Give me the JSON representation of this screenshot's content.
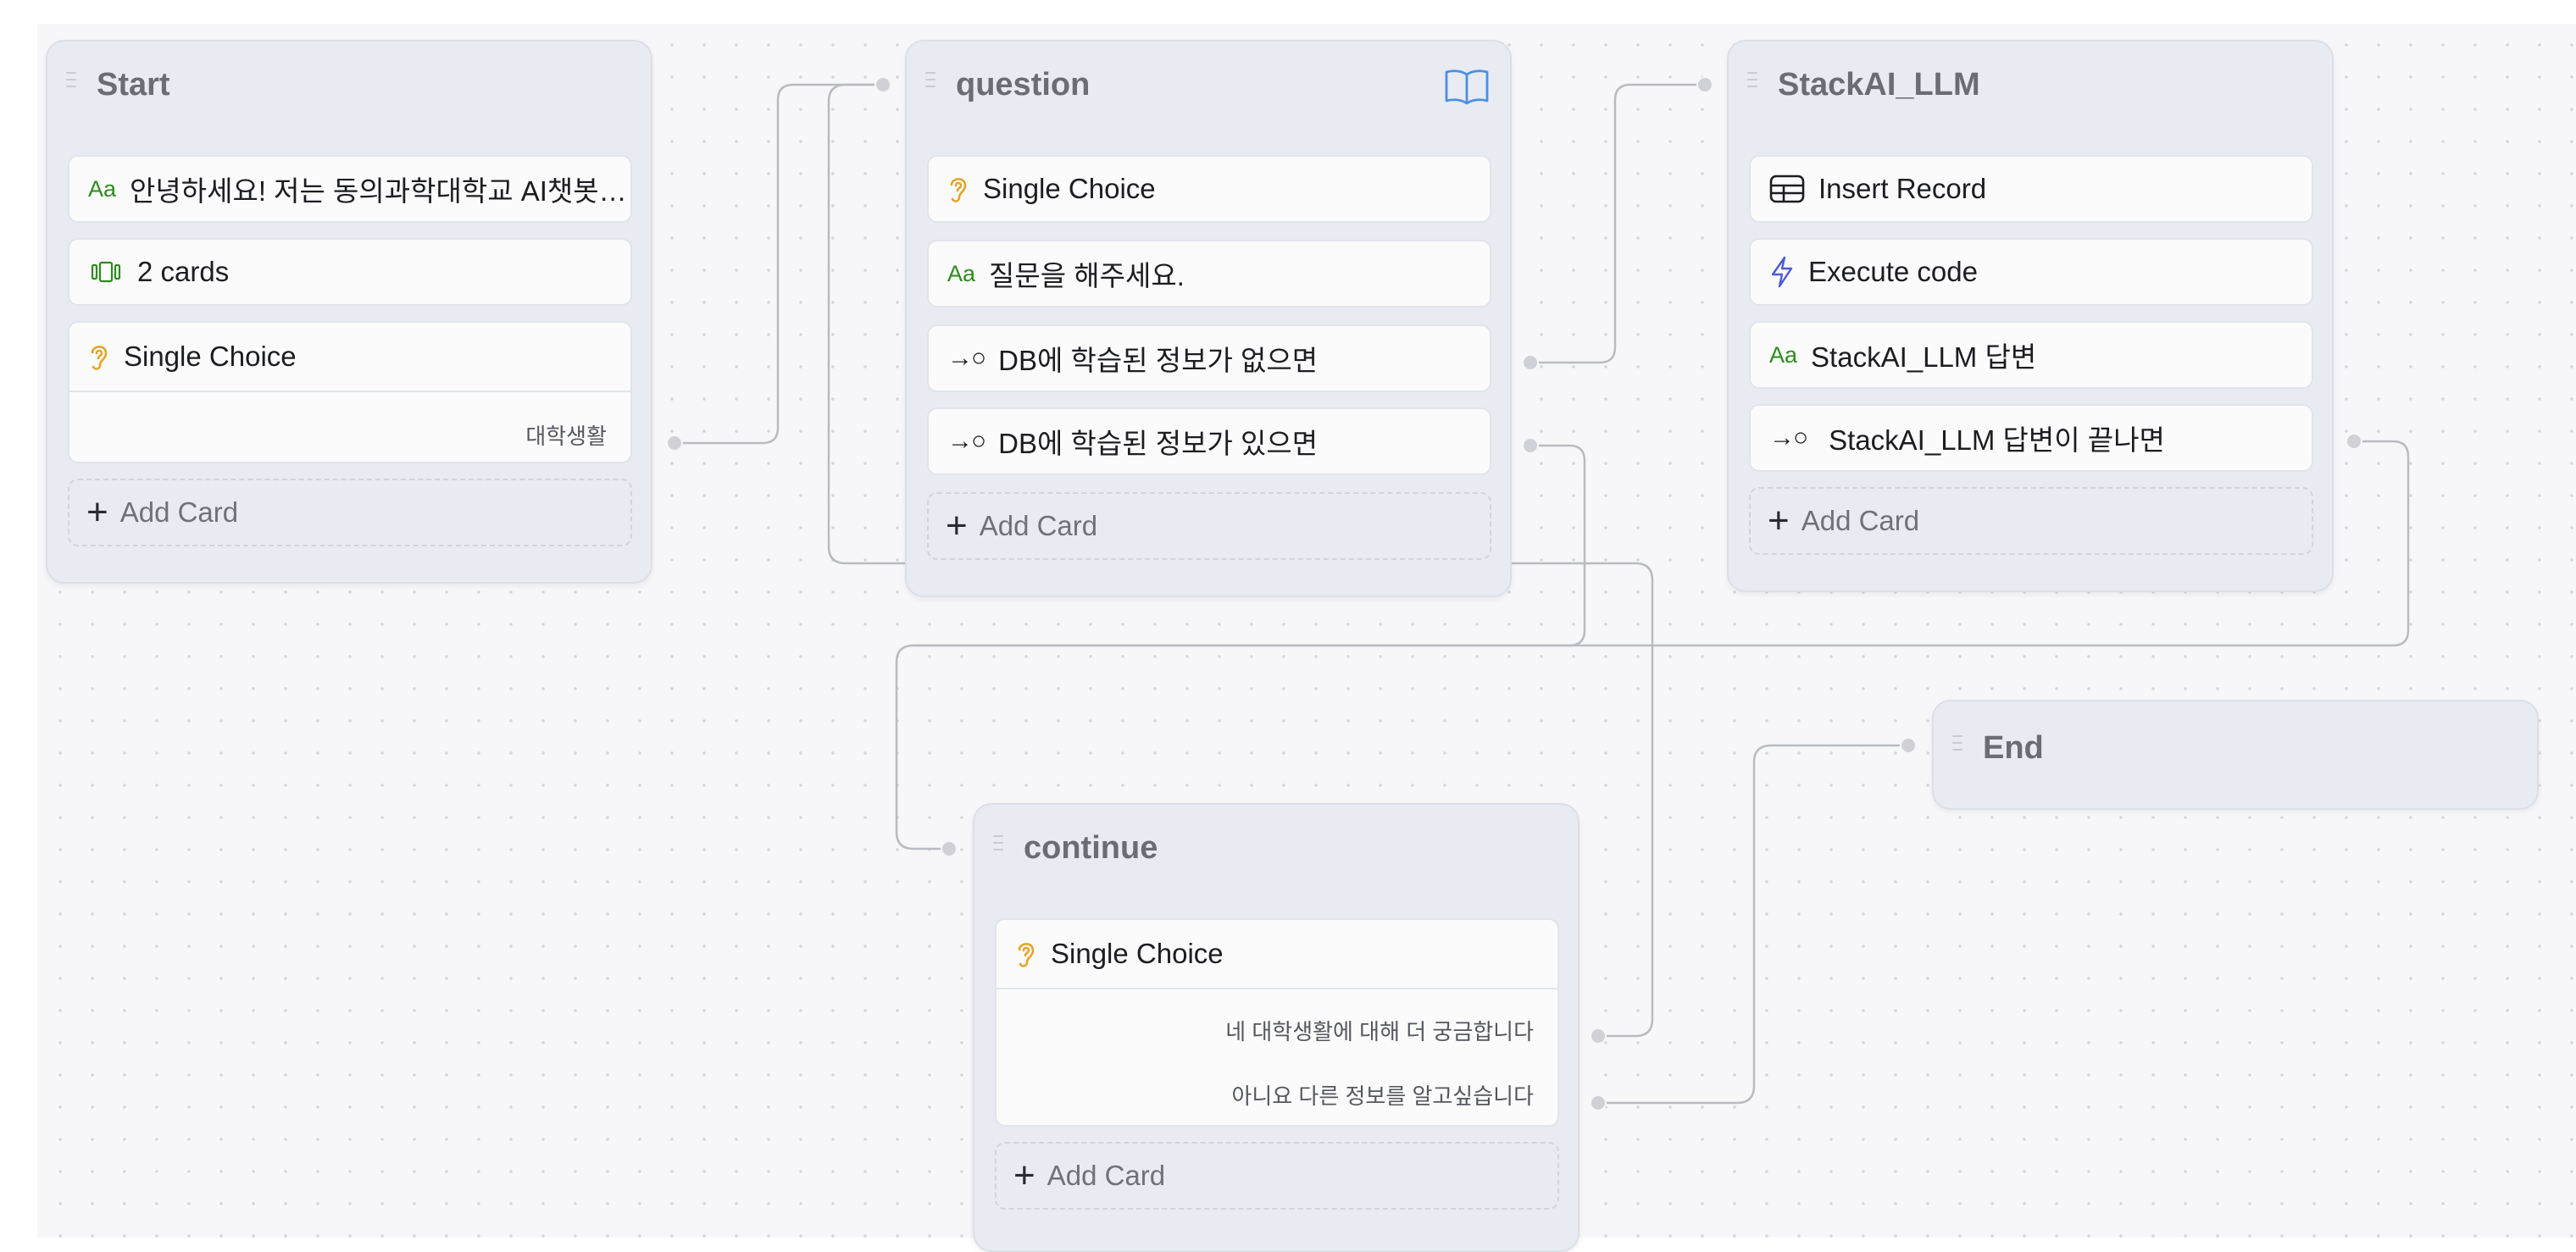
{
  "groups": {
    "start": {
      "title": "Start",
      "text_card": "안녕하세요! 저는 동의과학대학교 AI챗봇입...",
      "cards_card": "2 cards",
      "choice_card": {
        "label": "Single Choice",
        "items": [
          "대학생활"
        ]
      },
      "add_card": "Add Card"
    },
    "question": {
      "title": "question",
      "choice_card": "Single Choice",
      "text_card": "질문을 해주세요.",
      "condition_1": "DB에 학습된 정보가 없으면",
      "condition_2": "DB에 학습된 정보가 있으면",
      "add_card": "Add Card"
    },
    "stackai": {
      "title": "StackAI_LLM",
      "insert_card": "Insert Record",
      "code_card": "Execute code",
      "text_card": "StackAI_LLM 답변",
      "condition_card": "StackAI_LLM 답변이 끝나면",
      "add_card": "Add Card"
    },
    "end": {
      "title": "End"
    },
    "continue": {
      "title": "continue",
      "choice_card": {
        "label": "Single Choice",
        "items": [
          "네 대학생활에 대해 더 궁금합니다",
          "아니요 다른 정보를 알고싶습니다"
        ]
      },
      "add_card": "Add Card"
    }
  },
  "icons": {
    "text": "Aa",
    "condition": "→○",
    "choice": "ear-icon",
    "cards": "cards-icon",
    "insert": "table-icon",
    "code": "lightning-icon",
    "book": "book-icon"
  },
  "colors": {
    "canvas_bg": "#f7f7f9",
    "group_bg": "#e9ebf2",
    "edge": "#b9bbc2",
    "text_icon": "#2e8b1e",
    "choice_icon": "#e5a329",
    "book_icon": "#4a90e2",
    "lightning_icon": "#4b5bd6"
  }
}
